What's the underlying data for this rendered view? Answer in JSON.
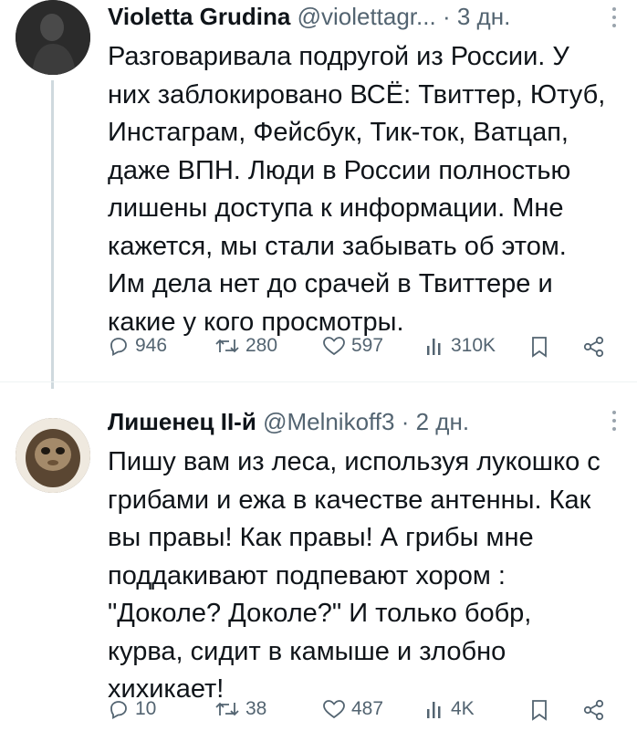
{
  "tweets": [
    {
      "author_name": "Violetta Grudina",
      "handle": "@violettagr...",
      "separator": "·",
      "time": "3 дн.",
      "text_lines": [
        "Разговаривала подругой из России. У",
        "них заблокировано ВСЁ: Твиттер, Ютуб,",
        "Инстаграм, Фейсбук, Тик-ток, Ватцап,",
        "даже ВПН. Люди в России полностью",
        "лишены доступа к информации. Мне",
        "кажется, мы стали забывать об этом.",
        "Им дела нет до срачей в Твиттере и",
        "какие у кого просмотры."
      ],
      "replies": "946",
      "retweets": "280",
      "likes": "597",
      "views": "310K"
    },
    {
      "author_name": "Лишенец II-й",
      "handle": "@Melnikoff3",
      "separator": "·",
      "time": "2 дн.",
      "text_lines": [
        "Пишу вам из леса, используя лукошко с",
        "грибами и ежа в качестве антенны. Как",
        "вы правы! Как правы! А грибы мне",
        "поддакивают подпевают хором :",
        "\"Доколе? Доколе?\" И только бобр,",
        "курва, сидит в камыше и злобно",
        "хихикает!"
      ],
      "replies": "10",
      "retweets": "38",
      "likes": "487",
      "views": "4K"
    }
  ],
  "colors": {
    "text": "#0f1419",
    "secondary": "#536471",
    "thread_line": "#cfd9de",
    "divider": "#eff3f4"
  },
  "icons": [
    "reply-icon",
    "retweet-icon",
    "like-icon",
    "views-icon",
    "bookmark-icon",
    "share-icon",
    "more-icon"
  ]
}
